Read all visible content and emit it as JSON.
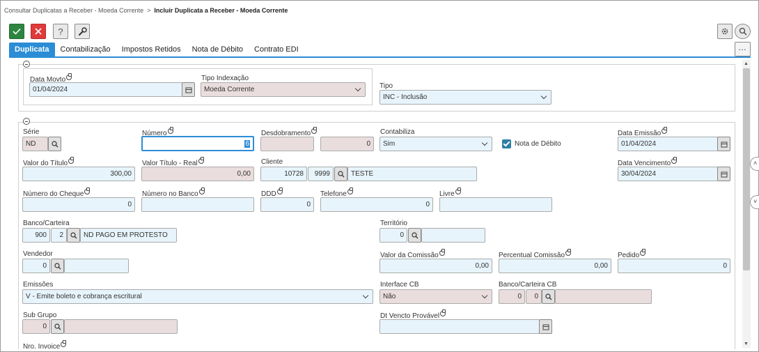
{
  "breadcrumb": {
    "parent": "Consultar Duplicatas a Receber - Moeda Corrente",
    "current": "Incluir Duplicata a Receber - Moeda Corrente"
  },
  "toolbar": {
    "confirm_icon": "check-icon",
    "cancel_icon": "close-icon",
    "help_label": "?",
    "tools_icon": "wrench-icon"
  },
  "tabs": [
    "Duplicata",
    "Contabilização",
    "Impostos Retidos",
    "Nota de Débito",
    "Contrato EDI"
  ],
  "colors": {
    "accent": "#2b8dd6",
    "confirm": "#2e8540",
    "cancel": "#e03b3b",
    "editable": "#e7f4fb",
    "readonly": "#eadddd"
  },
  "form": {
    "data_movto": {
      "label": "Data Movto",
      "value": "01/04/2024"
    },
    "tipo_indexacao": {
      "label": "Tipo Indexação",
      "value": "Moeda Corrente"
    },
    "tipo": {
      "label": "Tipo",
      "value": "INC - Inclusão"
    },
    "serie": {
      "label": "Série",
      "value": "ND"
    },
    "numero": {
      "label": "Número",
      "value": "6"
    },
    "desdobramento": {
      "label": "Desdobramento",
      "value1": "",
      "value2": "0"
    },
    "contabiliza": {
      "label": "Contabiliza",
      "value": "Sim"
    },
    "nota_debito": {
      "label": "Nota de Débito",
      "checked": true
    },
    "data_emissao": {
      "label": "Data Emissão",
      "value": "01/04/2024"
    },
    "valor_titulo": {
      "label": "Valor do Título",
      "value": "300,00"
    },
    "valor_titulo_real": {
      "label": "Valor Título - Real",
      "value": "0,00"
    },
    "cliente": {
      "label": "Cliente",
      "code": "10728",
      "sub": "9999",
      "name": "TESTE"
    },
    "data_vencimento": {
      "label": "Data Vencimento",
      "value": "30/04/2024"
    },
    "numero_cheque": {
      "label": "Número do Cheque",
      "value": "0"
    },
    "numero_banco": {
      "label": "Número no Banco",
      "value": ""
    },
    "ddd": {
      "label": "DDD",
      "value": "0"
    },
    "telefone": {
      "label": "Telefone",
      "value": "0"
    },
    "livre": {
      "label": "Livre",
      "value": ""
    },
    "banco_carteira": {
      "label": "Banco/Carteira",
      "banco": "900",
      "carteira": "2",
      "desc": "ND PAGO EM PROTESTO"
    },
    "territorio": {
      "label": "Território",
      "value": "0",
      "desc": ""
    },
    "vendedor": {
      "label": "Vendedor",
      "value": "0",
      "desc": ""
    },
    "valor_comissao": {
      "label": "Valor da Comissão",
      "value": "0,00"
    },
    "percentual_comissao": {
      "label": "Percentual Comissão",
      "value": "0,00"
    },
    "pedido": {
      "label": "Pedido",
      "value": "0"
    },
    "emissoes": {
      "label": "Emissões",
      "value": "V - Emite boleto e cobrança escritural"
    },
    "interface_cb": {
      "label": "Interface CB",
      "value": "Não"
    },
    "banco_carteira_cb": {
      "label": "Banco/Carteira CB",
      "banco": "0",
      "carteira": "0",
      "desc": ""
    },
    "sub_grupo": {
      "label": "Sub Grupo",
      "value": "0",
      "desc": ""
    },
    "dt_vencto_provavel": {
      "label": "Dt Vencto Provável",
      "value": ""
    },
    "nro_invoice": {
      "label": "Nro. Invoice"
    }
  }
}
